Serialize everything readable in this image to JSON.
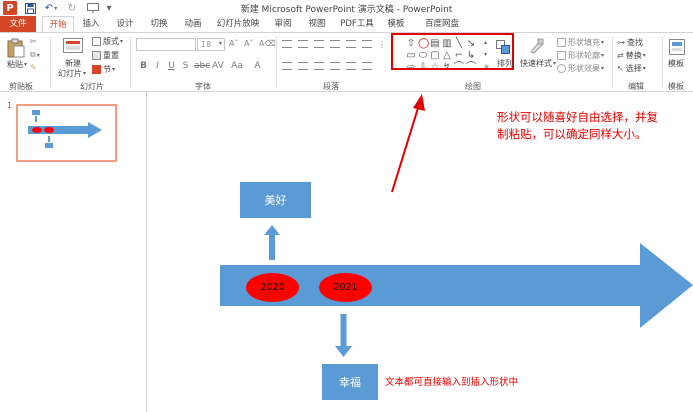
{
  "titlebar": {
    "app_logo": "P",
    "title": "新建 Microsoft PowerPoint 演示文稿 - PowerPoint"
  },
  "tabs": [
    {
      "label": "文件"
    },
    {
      "label": "开始"
    },
    {
      "label": "插入"
    },
    {
      "label": "设计"
    },
    {
      "label": "切换"
    },
    {
      "label": "动画"
    },
    {
      "label": "幻灯片放映"
    },
    {
      "label": "审阅"
    },
    {
      "label": "视图"
    },
    {
      "label": "PDF工具"
    },
    {
      "label": "模板"
    },
    {
      "label": "百度网盘"
    }
  ],
  "ribbon": {
    "clipboard": {
      "paste": "粘贴",
      "label": "剪贴板"
    },
    "slides": {
      "new_slide_line1": "新建",
      "new_slide_line2": "幻灯片",
      "layout": "版式",
      "reset": "重置",
      "section": "节",
      "label": "幻灯片"
    },
    "font": {
      "size": "18",
      "label": "字体"
    },
    "paragraph": {
      "label": "段落"
    },
    "drawing": {
      "arrange": "排列",
      "quick_styles": "快速样式",
      "shape_fill": "形状填充",
      "shape_outline": "形状轮廓",
      "shape_effects": "形状效果",
      "label": "绘图"
    },
    "editing": {
      "find": "查找",
      "replace": "替换",
      "select": "选择",
      "label": "编辑"
    },
    "template": {
      "label": "模板",
      "button": "模板"
    }
  },
  "thumbnails": [
    {
      "number": "1"
    }
  ],
  "slide": {
    "box_top": "美好",
    "box_bottom": "幸福",
    "year_1": "2020",
    "year_2": "2021",
    "note_top_line1": "形状可以随喜好自由选择，并复",
    "note_top_line2": "制粘贴，可以确定同样大小。",
    "note_bottom": "文本都可直接输入到插入形状中"
  },
  "colors": {
    "accent": "#d24726",
    "shape_blue": "#5b9bd5",
    "ellipse_red": "#ff0000",
    "annotation_red": "#e00000"
  }
}
